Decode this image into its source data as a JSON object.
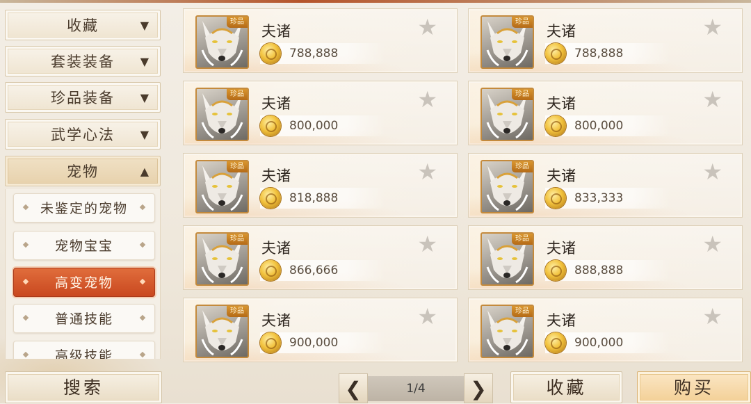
{
  "categories": [
    {
      "label": "收藏",
      "arrow": "▼"
    },
    {
      "label": "套装装备",
      "arrow": "▼"
    },
    {
      "label": "珍品装备",
      "arrow": "▼"
    },
    {
      "label": "武学心法",
      "arrow": "▼"
    },
    {
      "label": "宠物",
      "arrow": "▲"
    }
  ],
  "subcategories": [
    {
      "label": "未鉴定的宠物"
    },
    {
      "label": "宠物宝宝"
    },
    {
      "label": "高变宠物",
      "active": true
    },
    {
      "label": "普通技能"
    },
    {
      "label": "高级技能"
    }
  ],
  "items": [
    {
      "name": "夫诸",
      "badge": "珍品",
      "price": "788,888"
    },
    {
      "name": "夫诸",
      "badge": "珍品",
      "price": "788,888"
    },
    {
      "name": "夫诸",
      "badge": "珍品",
      "price": "800,000"
    },
    {
      "name": "夫诸",
      "badge": "珍品",
      "price": "800,000"
    },
    {
      "name": "夫诸",
      "badge": "珍品",
      "price": "818,888"
    },
    {
      "name": "夫诸",
      "badge": "珍品",
      "price": "833,333"
    },
    {
      "name": "夫诸",
      "badge": "珍品",
      "price": "866,666"
    },
    {
      "name": "夫诸",
      "badge": "珍品",
      "price": "888,888"
    },
    {
      "name": "夫诸",
      "badge": "珍品",
      "price": "900,000"
    },
    {
      "name": "夫诸",
      "badge": "珍品",
      "price": "900,000"
    }
  ],
  "icons": {
    "star": "star-icon",
    "coin": "gold-coin-icon",
    "prev": "chevron-left-icon",
    "next": "chevron-right-icon"
  },
  "bottom": {
    "search_label": "搜索",
    "page_indicator": "1/4",
    "prev_glyph": "❮",
    "next_glyph": "❯",
    "favorite_label": "收藏",
    "buy_label": "购买"
  },
  "colors": {
    "active_tab": "#d65a2c",
    "accent_gold": "#c48a3c"
  }
}
